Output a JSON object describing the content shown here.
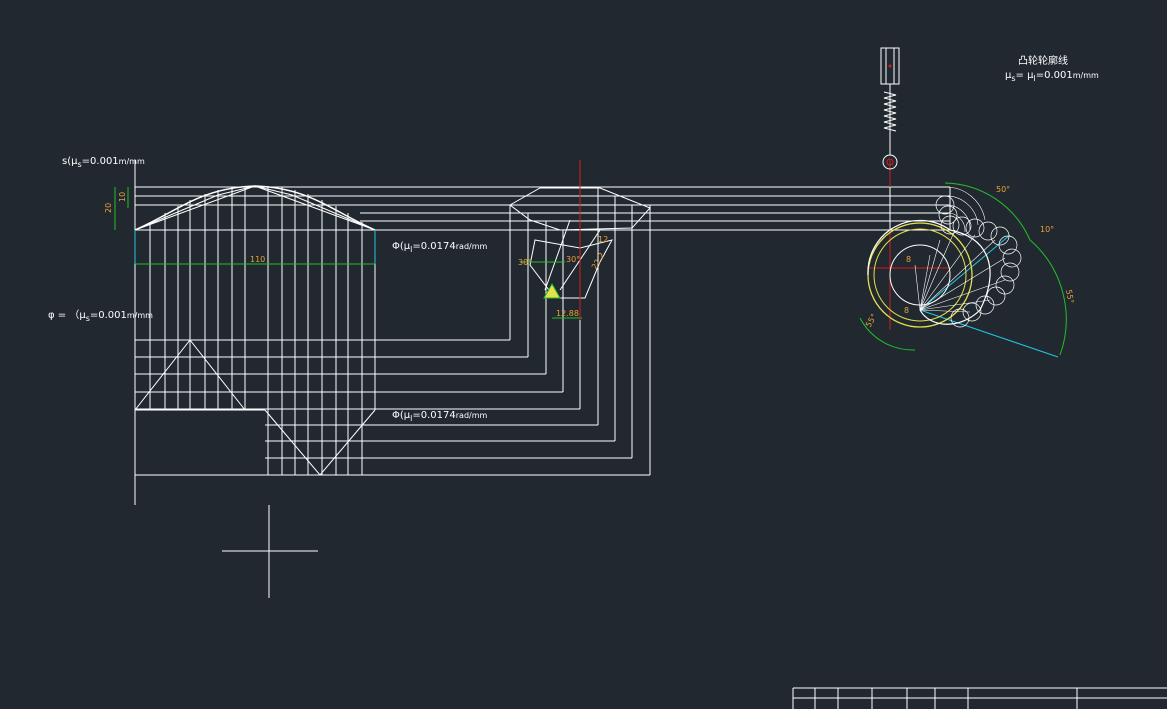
{
  "colors": {
    "background": "#212830",
    "line": "#ffffff",
    "dimension": "#22c02a",
    "dim_text": "#e8a23c",
    "center": "#d21e1e",
    "cam": "#e6e04a",
    "cyan": "#22c8e0"
  },
  "labels": {
    "s_axis": "s(μ",
    "s_axis_sub": "s",
    "s_axis_val": "=0.001",
    "s_axis_unit": "m/mm",
    "cam_title": "凸轮轮廓线",
    "cam_scale": "μ",
    "cam_scale_sub1": "s",
    "cam_scale_mid": "= μ",
    "cam_scale_sub2": "l",
    "cam_scale_val": "=0.001",
    "cam_scale_unit": "m/mm",
    "phi_label_1": "Φ(μ",
    "phi_label_1_sub": "l",
    "phi_label_1_val": "=0.0174",
    "phi_label_1_unit": "rad/mm",
    "phi_label_2": "Φ(μ",
    "phi_label_2_sub": "l",
    "phi_label_2_val": "=0.0174",
    "phi_label_2_unit": "rad/mm",
    "side_label": "φ = （μ",
    "side_label_sub": "s",
    "side_label_val": "=0.001",
    "side_label_unit": "m/mm"
  },
  "dimensions": {
    "d20": "20",
    "d10": "10",
    "d110": "110",
    "d30a": "30°",
    "d30b": "30°",
    "d12": "12",
    "d22": "22.2",
    "d1288": "12.88",
    "a50": "50°",
    "a10": "10°",
    "a55": "55°",
    "r8": "8",
    "r1": "8",
    "a_small": "55°"
  }
}
